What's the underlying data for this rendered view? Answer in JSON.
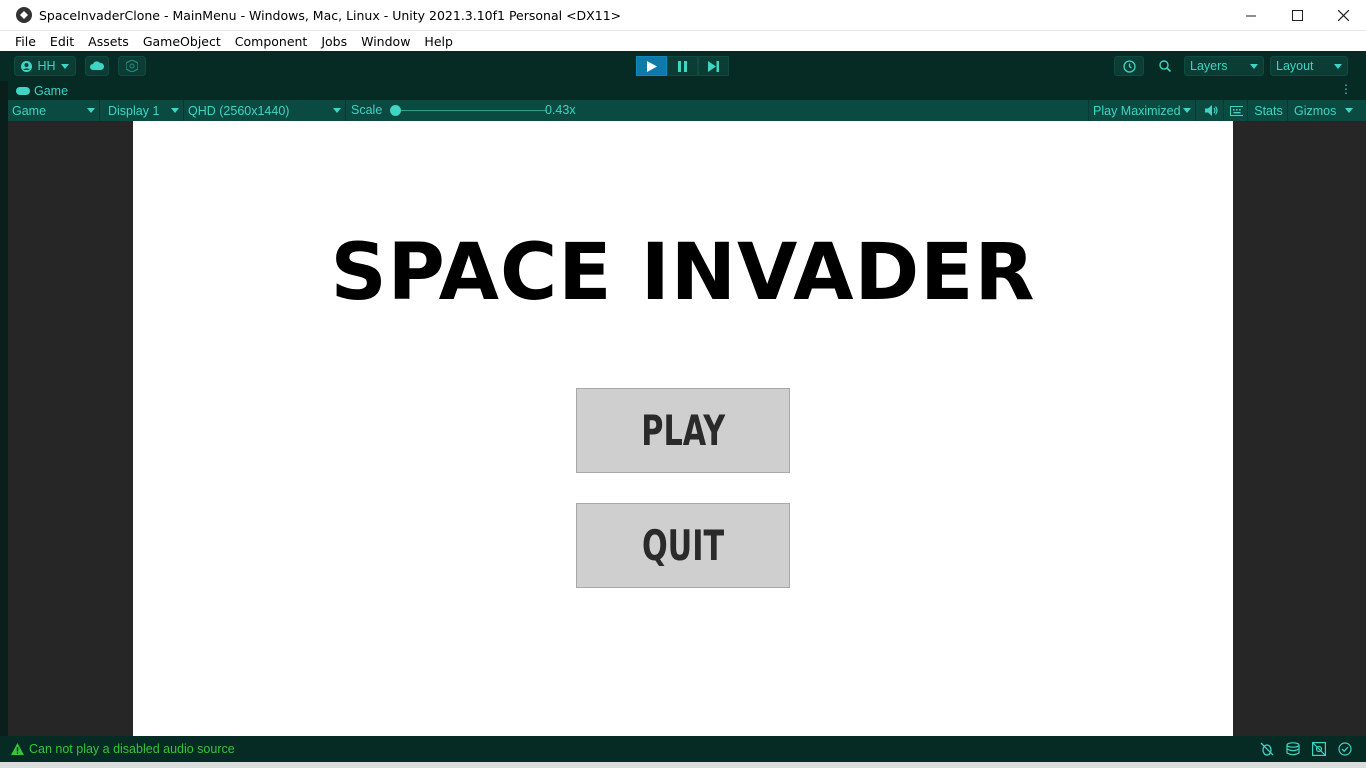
{
  "window": {
    "title": "SpaceInvaderClone - MainMenu - Windows, Mac, Linux - Unity 2021.3.10f1 Personal <DX11>"
  },
  "menu": {
    "items": [
      "File",
      "Edit",
      "Assets",
      "GameObject",
      "Component",
      "Jobs",
      "Window",
      "Help"
    ]
  },
  "toolbar": {
    "account_label": "HH",
    "layers_label": "Layers",
    "layout_label": "Layout",
    "play_active": true
  },
  "game_tab": {
    "label": "Game"
  },
  "game_toolbar": {
    "view_mode": "Game",
    "display": "Display 1",
    "resolution": "QHD (2560x1440)",
    "scale_label": "Scale",
    "scale_value": "0.43x",
    "play_mode": "Play Maximized",
    "stats_label": "Stats",
    "gizmos_label": "Gizmos"
  },
  "game": {
    "title": "SPACE INVADER",
    "play_button": "PLAY",
    "quit_button": "QUIT"
  },
  "status": {
    "message": "Can not play a disabled audio source"
  },
  "colors": {
    "accent": "#3fd4c3",
    "toolbar_bg": "#062a24",
    "play_active": "#0f7aaa",
    "warning": "#35c53b"
  }
}
